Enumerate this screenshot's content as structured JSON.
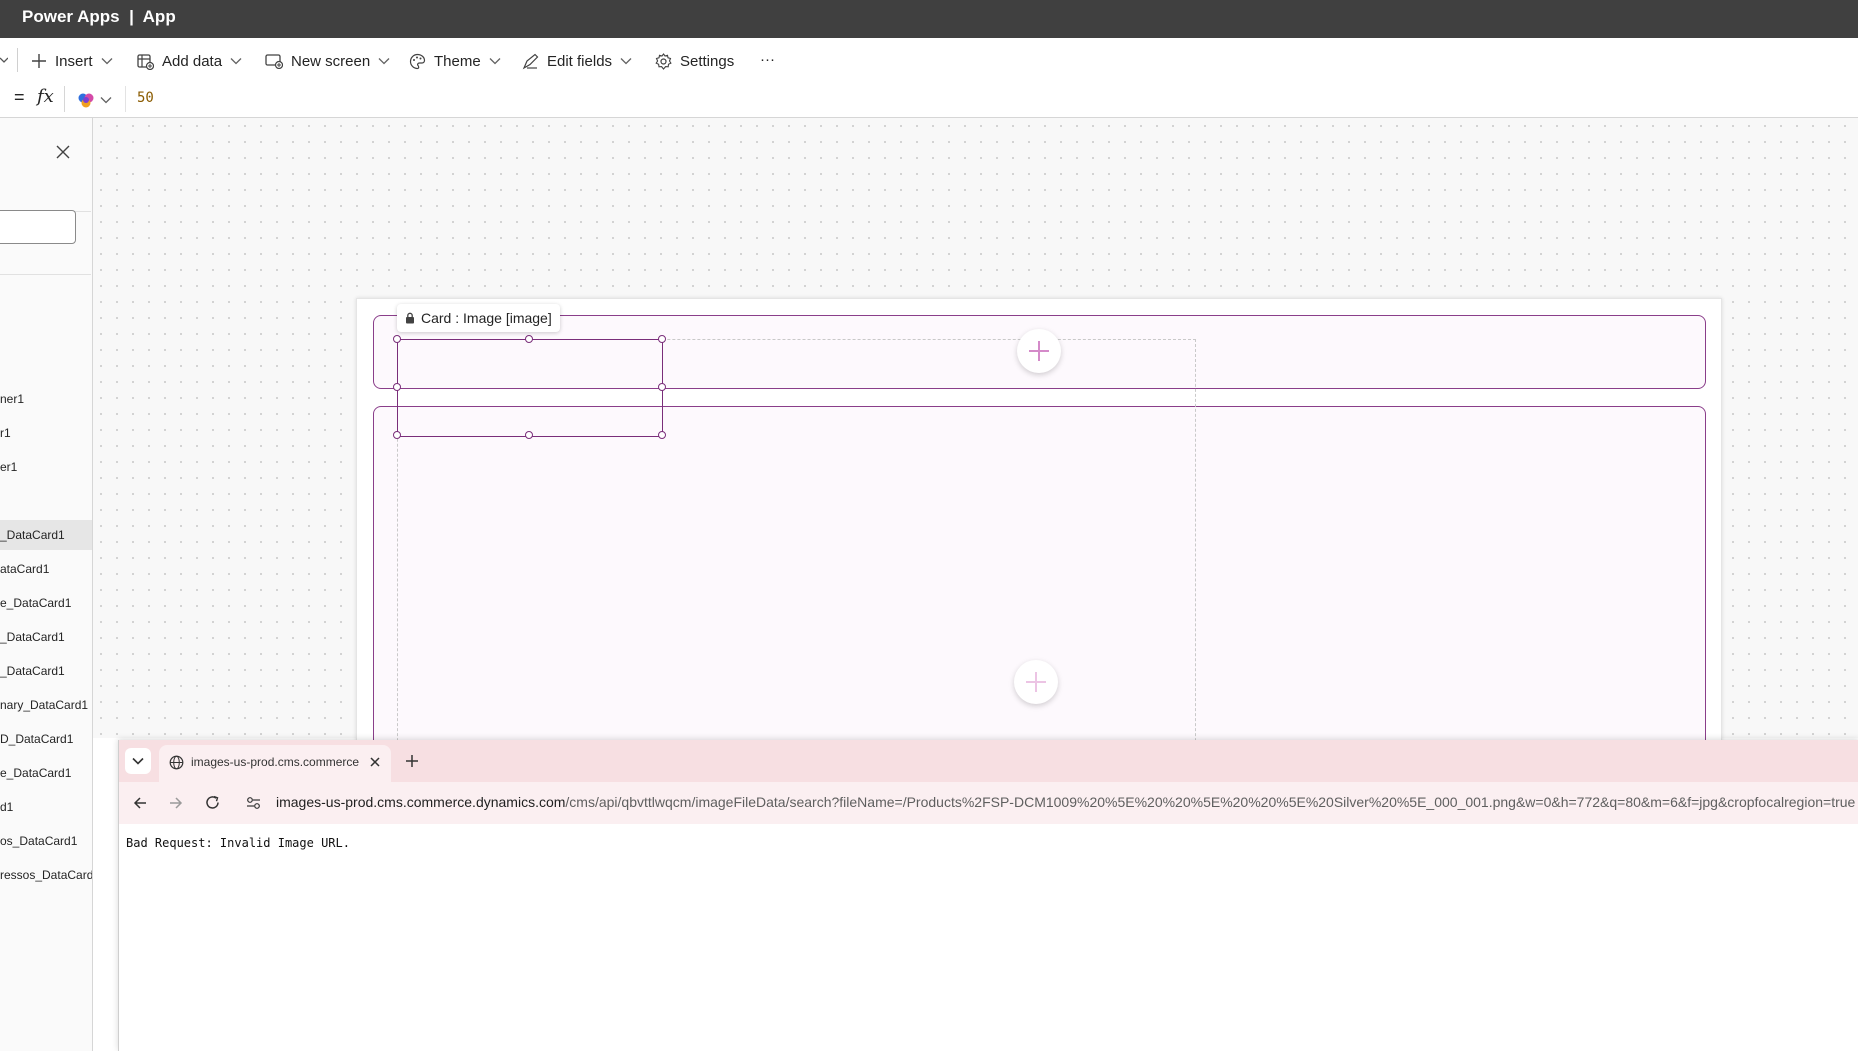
{
  "title_bar": {
    "app_name": "Power Apps",
    "separator": "|",
    "app_title": "App"
  },
  "toolbar": {
    "items": [
      {
        "label": "Insert",
        "icon": "plus-icon"
      },
      {
        "label": "Add data",
        "icon": "table-add-icon"
      },
      {
        "label": "New screen",
        "icon": "new-screen-icon"
      },
      {
        "label": "Theme",
        "icon": "palette-icon"
      },
      {
        "label": "Edit fields",
        "icon": "edit-fields-icon"
      },
      {
        "label": "Settings",
        "icon": "gear-icon"
      }
    ],
    "more": "···"
  },
  "formula_bar": {
    "equals": "=",
    "fx": "fx",
    "value": "50"
  },
  "left_panel": {
    "tree_items": [
      {
        "label": "ner1"
      },
      {
        "label": "r1"
      },
      {
        "label": "er1"
      },
      {
        "label": "_DataCard1",
        "selected": true
      },
      {
        "label": "ataCard1"
      },
      {
        "label": "e_DataCard1"
      },
      {
        "label": "_DataCard1"
      },
      {
        "label": "_DataCard1"
      },
      {
        "label": "nary_DataCard1"
      },
      {
        "label": "D_DataCard1"
      },
      {
        "label": "e_DataCard1"
      },
      {
        "label": "d1"
      },
      {
        "label": "os_DataCard1"
      },
      {
        "label": "ressos_DataCard1"
      }
    ]
  },
  "canvas": {
    "tooltip": "Card : Image [image]"
  },
  "browser": {
    "tab_title": "images-us-prod.cms.commerce.dynamics.com",
    "url_host": "images-us-prod.cms.commerce.dynamics.com",
    "url_path": "/cms/api/qbvttlwqcm/imageFileData/search?fileName=/Products%2FSP-DCM1009%20%5E%20%20%5E%20%20%5E%20Silver%20%5E_000_001.png&w=0&h=772&q=80&m=6&f=jpg&cropfocalregion=true",
    "page_text": "Bad Request: Invalid Image URL."
  },
  "colors": {
    "accent": "#742774",
    "title_bar": "#404040",
    "browser_tab_strip": "#f7dfe2",
    "formula_value": "#8a5b00"
  }
}
